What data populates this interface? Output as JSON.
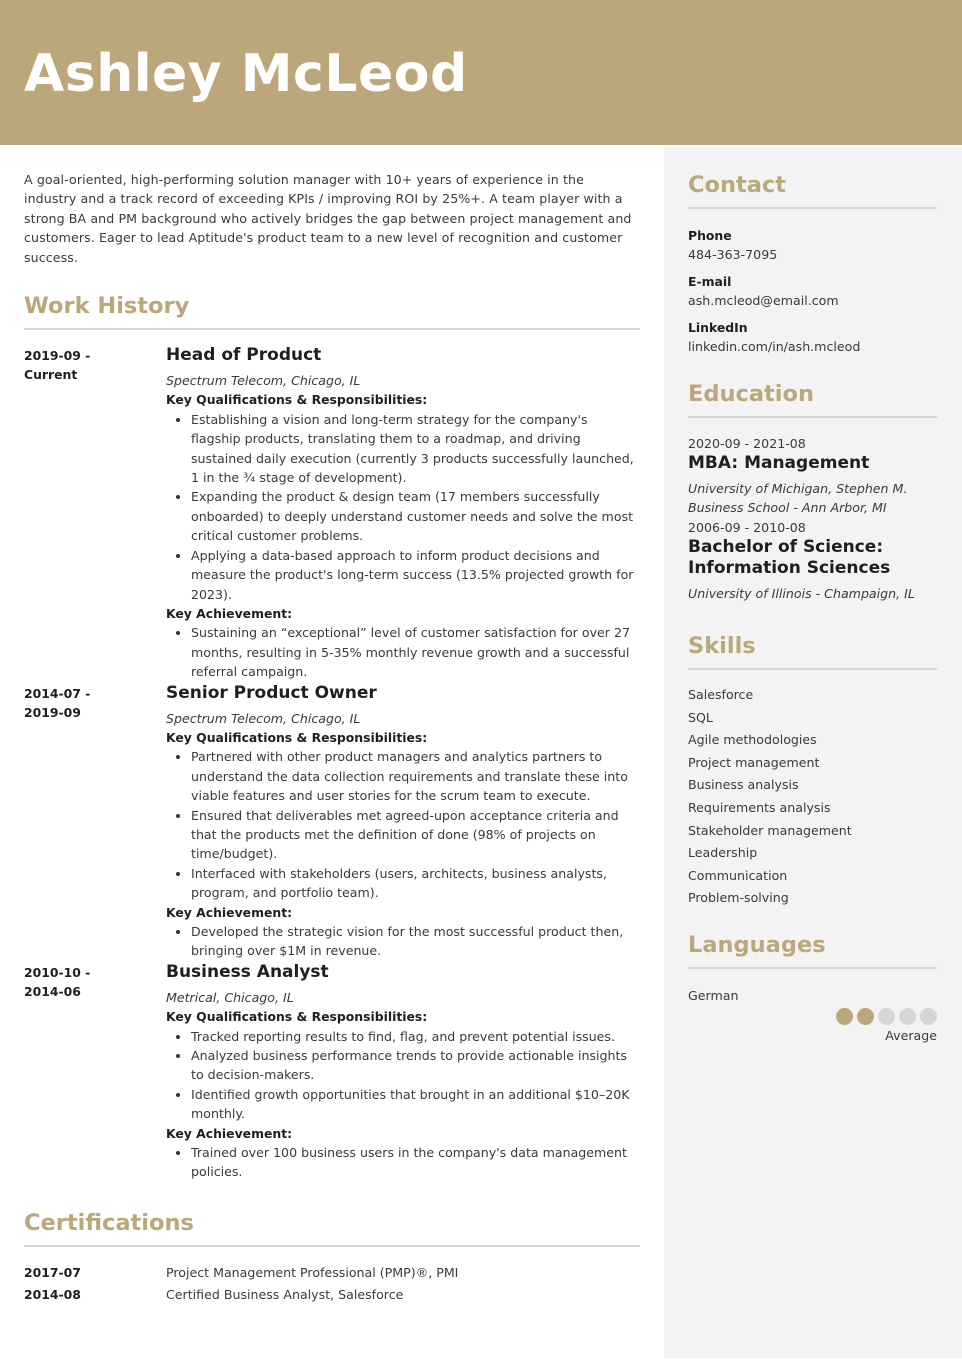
{
  "header": {
    "name": "Ashley McLeod"
  },
  "colors": {
    "accent": "#bca77a",
    "sidebar_bg": "#f3f3f3",
    "rule": "#d6d6d6",
    "text": "#3a3a3a"
  },
  "summary": "A goal-oriented, high-performing solution manager with 10+ years of experience in the industry and a track record of exceeding KPIs / improving ROI by 25%+. A team player with a strong BA and PM background who actively bridges the gap between project management and customers. Eager to lead Aptitude's product team to a new level of recognition and customer success.",
  "work_history": {
    "title": "Work History",
    "jobs": [
      {
        "date_start": "2019-09 -",
        "date_end": "Current",
        "title": "Head of Product",
        "company": "Spectrum Telecom, Chicago, IL",
        "qual_label": "Key Qualifications & Responsibilities:",
        "responsibilities": [
          "Establishing a vision and long-term strategy for the company's flagship products, translating them to a roadmap, and driving sustained daily execution (currently 3 products successfully launched, 1 in the ¾ stage of development).",
          "Expanding the product & design team (17 members successfully onboarded) to deeply understand customer needs and solve the most critical customer problems.",
          "Applying a data-based approach to inform product decisions and measure the product's long-term success (13.5% projected growth for 2023)."
        ],
        "ach_label": "Key Achievement:",
        "achievements": [
          "Sustaining an “exceptional” level of customer satisfaction for over 27 months, resulting in 5-35% monthly revenue growth and a successful referral campaign."
        ]
      },
      {
        "date_start": "2014-07 -",
        "date_end": "2019-09",
        "title": "Senior Product Owner",
        "company": "Spectrum Telecom, Chicago, IL",
        "qual_label": "Key Qualifications & Responsibilities:",
        "responsibilities": [
          "Partnered with other product managers and analytics partners to understand the data collection requirements and translate these into viable features and user stories for the scrum team to execute.",
          "Ensured that deliverables met agreed-upon acceptance criteria and that the products met the definition of done (98% of projects on time/budget).",
          "Interfaced with stakeholders (users, architects, business analysts, program, and portfolio team)."
        ],
        "ach_label": "Key Achievement:",
        "achievements": [
          "Developed the strategic vision for the most successful product then, bringing over $1M in revenue."
        ]
      },
      {
        "date_start": "2010-10 -",
        "date_end": "2014-06",
        "title": "Business Analyst",
        "company": "Metrical, Chicago, IL",
        "qual_label": "Key Qualifications & Responsibilities:",
        "responsibilities": [
          "Tracked reporting results to find, flag, and prevent potential issues.",
          "Analyzed business performance trends to provide actionable insights to decision-makers.",
          "Identified growth opportunities that brought in an additional $10–20K monthly."
        ],
        "ach_label": "Key Achievement:",
        "achievements": [
          "Trained over 100 business users in the company's data management policies."
        ]
      }
    ]
  },
  "certifications": {
    "title": "Certifications",
    "items": [
      {
        "date": "2017-07",
        "name": "Project Management Professional (PMP)®, PMI"
      },
      {
        "date": "2014-08",
        "name": "Certified Business Analyst, Salesforce"
      }
    ]
  },
  "contact": {
    "title": "Contact",
    "items": [
      {
        "label": "Phone",
        "value": "484-363-7095"
      },
      {
        "label": "E-mail",
        "value": "ash.mcleod@email.com"
      },
      {
        "label": "LinkedIn",
        "value": "linkedin.com/in/ash.mcleod"
      }
    ]
  },
  "education": {
    "title": "Education",
    "items": [
      {
        "date": "2020-09 - 2021-08",
        "degree": "MBA: Management",
        "school": "University of Michigan, Stephen M. Business School - Ann Arbor, MI"
      },
      {
        "date": "2006-09 - 2010-08",
        "degree": "Bachelor of Science: Information Sciences",
        "school": "University of Illinois - Champaign, IL"
      }
    ]
  },
  "skills": {
    "title": "Skills",
    "items": [
      "Salesforce",
      "SQL",
      "Agile methodologies",
      "Project management",
      "Business analysis",
      "Requirements analysis",
      "Stakeholder management",
      "Leadership",
      "Communication",
      "Problem-solving"
    ]
  },
  "languages": {
    "title": "Languages",
    "items": [
      {
        "name": "German",
        "rating": 2,
        "max": 5,
        "level": "Average"
      }
    ]
  }
}
